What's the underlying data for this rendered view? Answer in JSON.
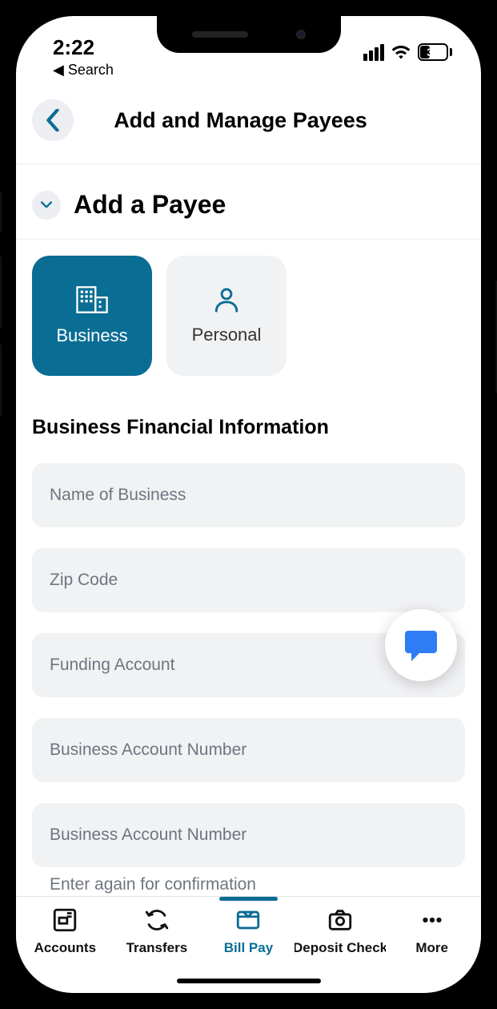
{
  "status": {
    "time": "2:22",
    "back": "◀ Search",
    "battery": "34"
  },
  "header": {
    "title": "Add and Manage Payees"
  },
  "section": {
    "title": "Add a Payee"
  },
  "payee_type": {
    "business": "Business",
    "personal": "Personal"
  },
  "form": {
    "title": "Business Financial Information",
    "fields": {
      "name": "Name of Business",
      "zip": "Zip Code",
      "funding": "Funding Account",
      "acct1": "Business Account Number",
      "acct2": "Business Account Number",
      "confirm_hint": "Enter again for confirmation"
    }
  },
  "tabs": {
    "accounts": "Accounts",
    "transfers": "Transfers",
    "billpay": "Bill Pay",
    "deposit": "Deposit Check",
    "more": "More"
  }
}
